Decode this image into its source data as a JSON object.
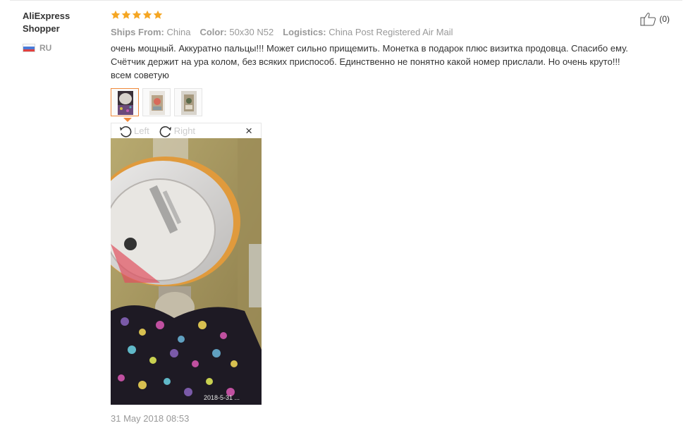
{
  "user": {
    "name": "AliExpress\nShopper",
    "country_code": "RU",
    "flag_colors": [
      "#ffffff",
      "#4a7bd8",
      "#e04040"
    ]
  },
  "rating": {
    "stars": 5,
    "max": 5,
    "star_color": "#f5a623"
  },
  "like": {
    "icon": "thumbs-up-icon",
    "count_text": "(0)"
  },
  "meta": {
    "ships_from_label": "Ships From:",
    "ships_from_value": "China",
    "color_label": "Color:",
    "color_value": "50x30 N52",
    "logistics_label": "Logistics:",
    "logistics_value": "China Post Registered Air Mail"
  },
  "review": {
    "text": "очень мощный. Аккуратно пальцы!!! Может сильно прищемить. Монетка в подарок плюс визитка продовца. Спасибо ему.\nСчётчик держит на ура колом, без всяких приспособ. Единственно не понятно какой номер прислали. Но очень круто!!!\nвсем советую"
  },
  "thumbnails": {
    "count": 3,
    "active_index": 0
  },
  "viewer": {
    "rotate_left_label": "Left",
    "rotate_right_label": "Right",
    "close_symbol": "×",
    "photo_timestamp": "2018-5-31 ..."
  },
  "accent_color": "#f08a3c",
  "date": "31 May 2018 08:53"
}
